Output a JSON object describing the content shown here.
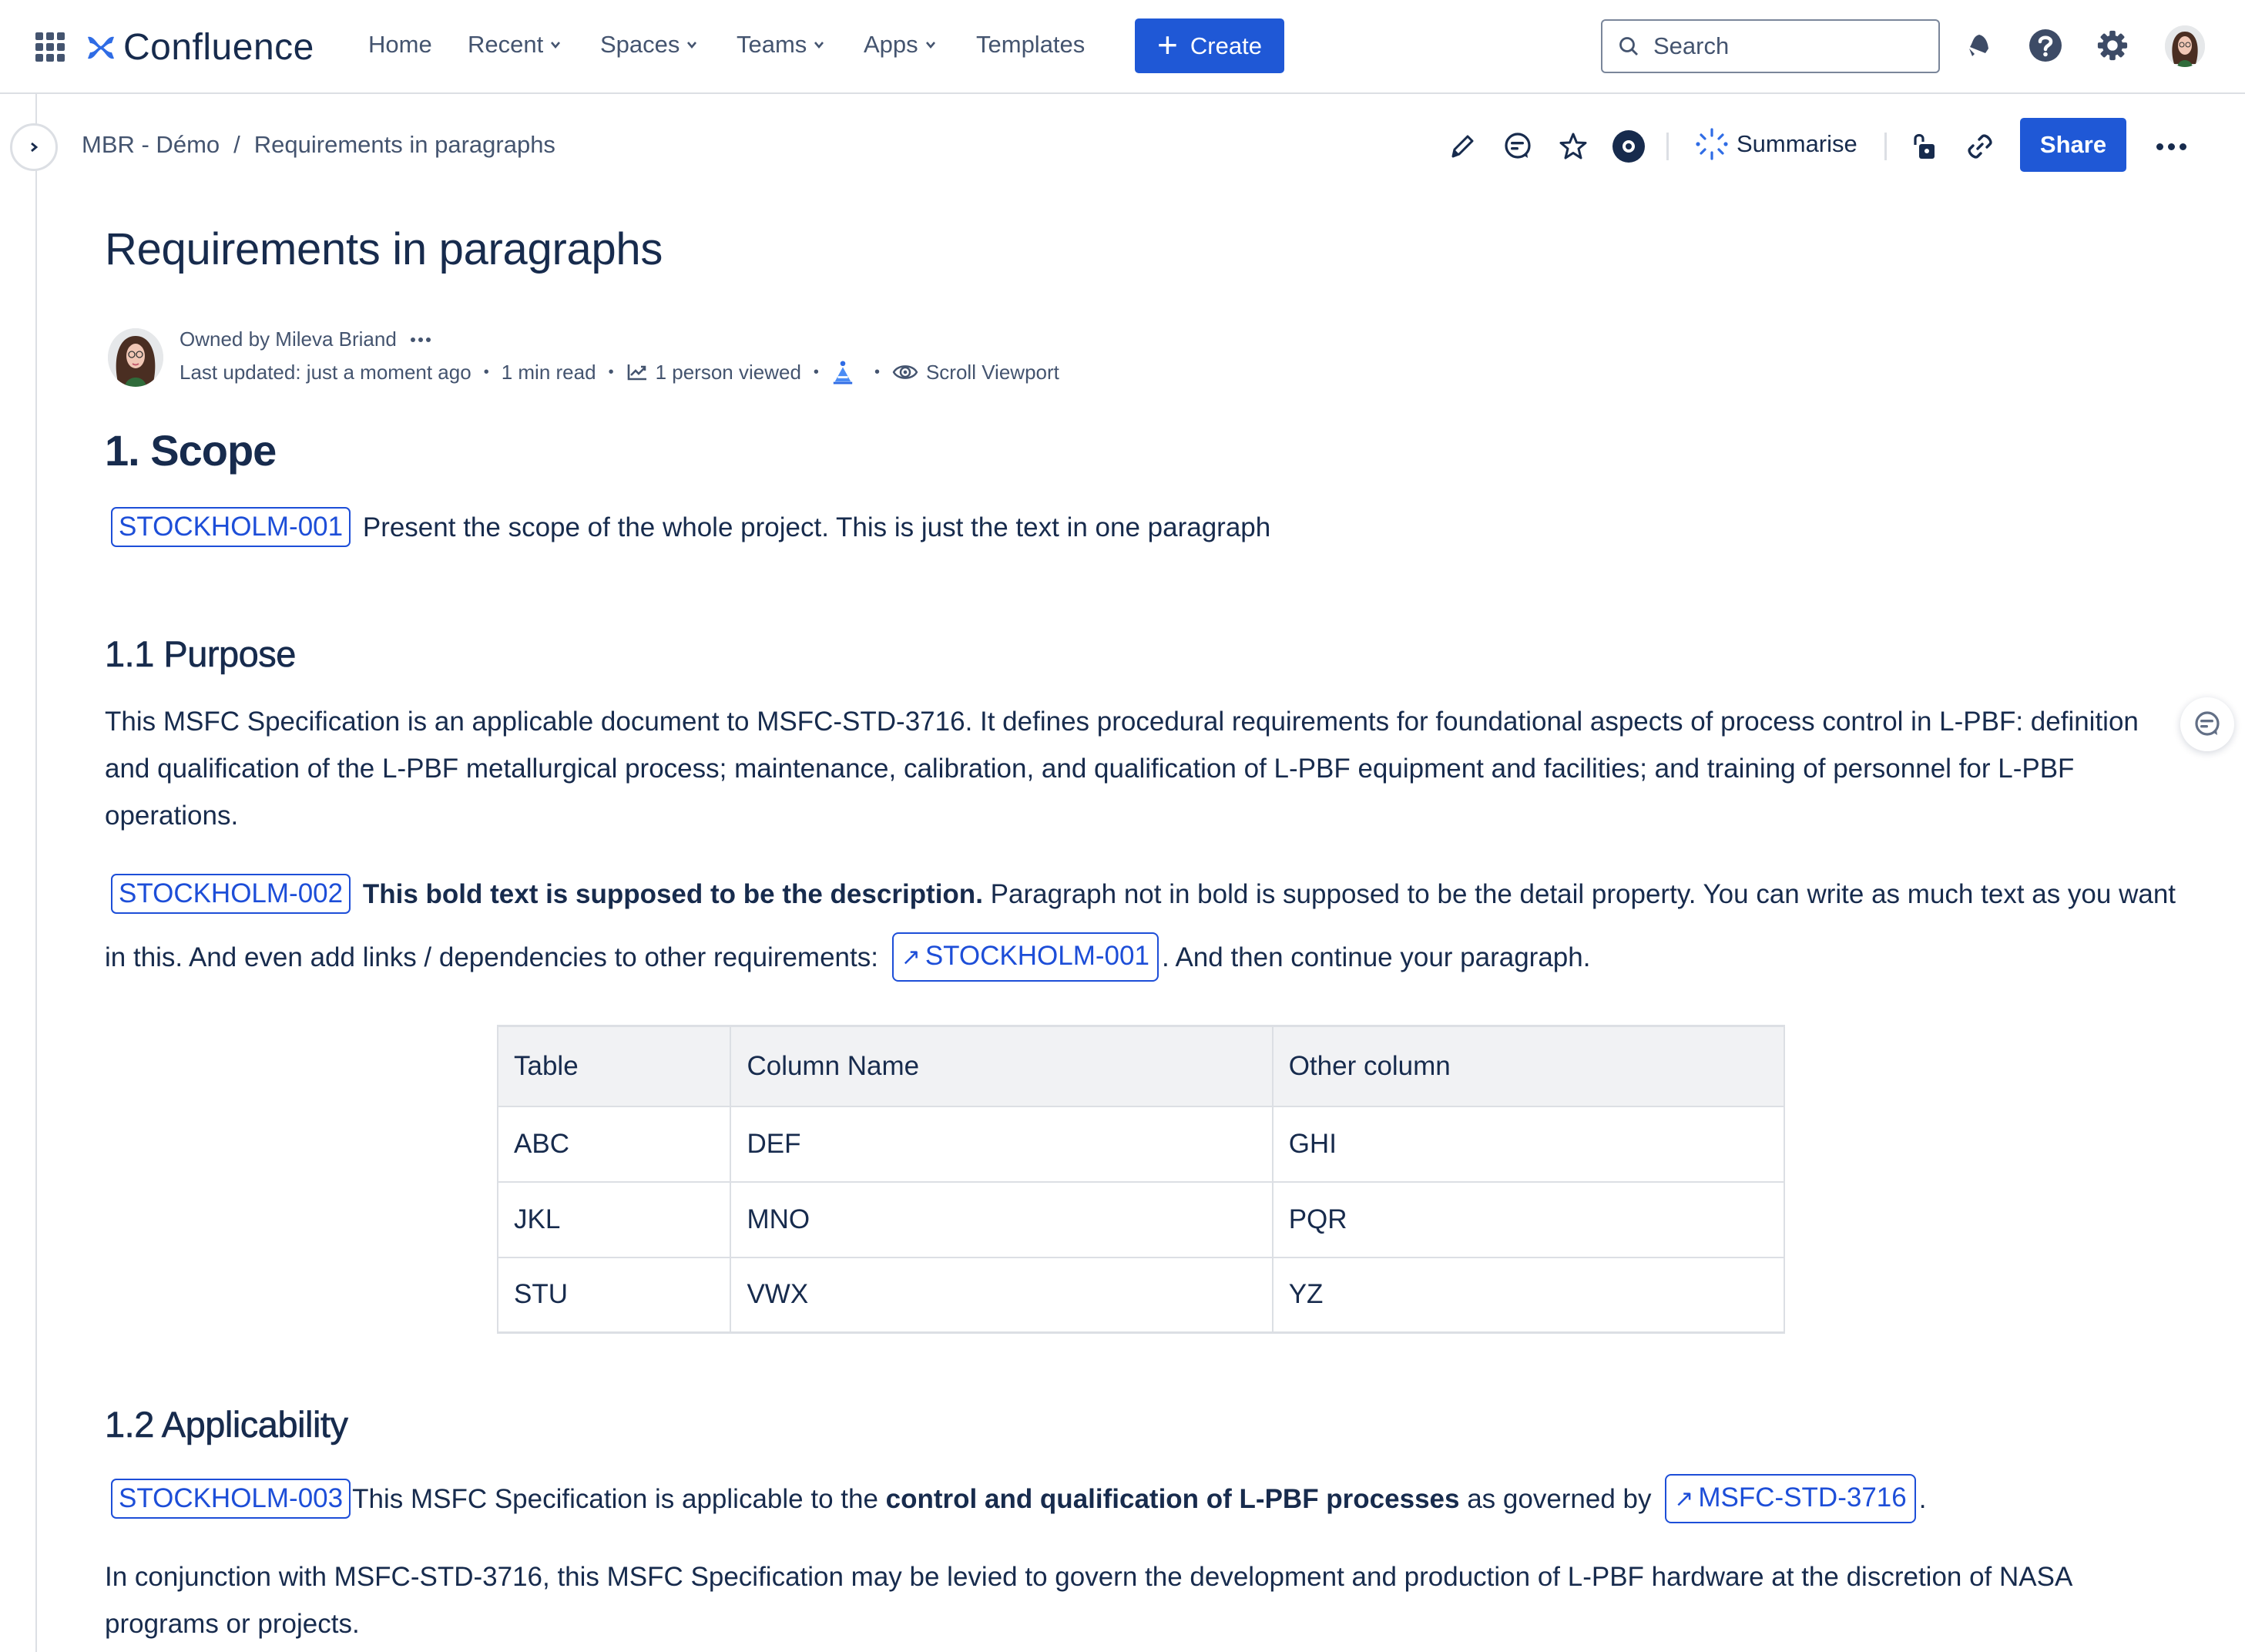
{
  "topnav": {
    "app_name": "Confluence",
    "items": [
      {
        "label": "Home",
        "has_dropdown": false
      },
      {
        "label": "Recent",
        "has_dropdown": true
      },
      {
        "label": "Spaces",
        "has_dropdown": true
      },
      {
        "label": "Teams",
        "has_dropdown": true
      },
      {
        "label": "Apps",
        "has_dropdown": true
      },
      {
        "label": "Templates",
        "has_dropdown": false
      }
    ],
    "create_label": "Create",
    "search_placeholder": "Search",
    "icons": [
      "app-switcher-icon",
      "notifications-bell-icon",
      "help-icon",
      "settings-gear-icon",
      "user-avatar"
    ],
    "brand_color": "#1f58d6"
  },
  "breadcrumb": {
    "items": [
      "MBR - Démo",
      "Requirements in paragraphs"
    ],
    "separator": "/"
  },
  "toolbar": {
    "icons": [
      "edit-pencil-icon",
      "comment-icon",
      "star-icon",
      "watch-eye-icon",
      "restrictions-unlock-icon",
      "copy-link-icon",
      "more-actions-icon"
    ],
    "summarise_label": "Summarise",
    "share_label": "Share"
  },
  "page": {
    "title": "Requirements in paragraphs",
    "byline": {
      "owner": "Owned by Mileva Briand",
      "last_updated": "Last updated: just a moment ago",
      "read_time": "1 min read",
      "views": "1 person viewed",
      "scroll_viewport": "Scroll Viewport"
    },
    "sections": {
      "scope": {
        "heading": "1. Scope",
        "req_id": "STOCKHOLM-001",
        "text": "Present the scope of the whole project. This is just the text in one paragraph"
      },
      "purpose": {
        "heading": "1.1 Purpose",
        "paragraph": "This MSFC Specification is an applicable document to MSFC-STD-3716. It defines procedural requirements for foundational aspects of process control in L-PBF: definition and qualification of the L-PBF metallurgical process; maintenance, calibration, and qualification of L-PBF equipment and facilities; and training of personnel for L-PBF operations.",
        "req_id": "STOCKHOLM-002",
        "bold_text": "This bold text is supposed to be the description.",
        "detail_text": " Paragraph not in bold is supposed to be the detail property. You can write as much text as you want in this. And even add links / dependencies to other requirements: ",
        "link_arrow": "↗",
        "link_label": "STOCKHOLM-001",
        "after_link": ". And then continue your paragraph."
      },
      "table": {
        "headers": [
          "Table",
          "Column Name",
          "Other column"
        ],
        "rows": [
          [
            "ABC",
            "DEF",
            "GHI"
          ],
          [
            "JKL",
            "MNO",
            "PQR"
          ],
          [
            "STU",
            "VWX",
            "YZ"
          ]
        ]
      },
      "applicability": {
        "heading": "1.2 Applicability",
        "req_id": "STOCKHOLM-003",
        "text_before": "This MSFC Specification is applicable to the ",
        "bold_text": "control and qualification of L-PBF processes",
        "text_mid": " as governed by ",
        "link_arrow": "↗",
        "link_label": "MSFC-STD-3716",
        "text_after": ".",
        "paragraph2": "In conjunction with MSFC-STD-3716, this MSFC Specification may be levied to govern the development and production of L-PBF hardware at the discretion of NASA programs or projects."
      }
    }
  },
  "colors": {
    "accent": "#1f58d6",
    "req_badge": "#1d4ed8",
    "text": "#172b4d",
    "subtle_text": "#44546f",
    "table_header_bg": "#f1f2f4",
    "border": "#dcdfe4"
  }
}
